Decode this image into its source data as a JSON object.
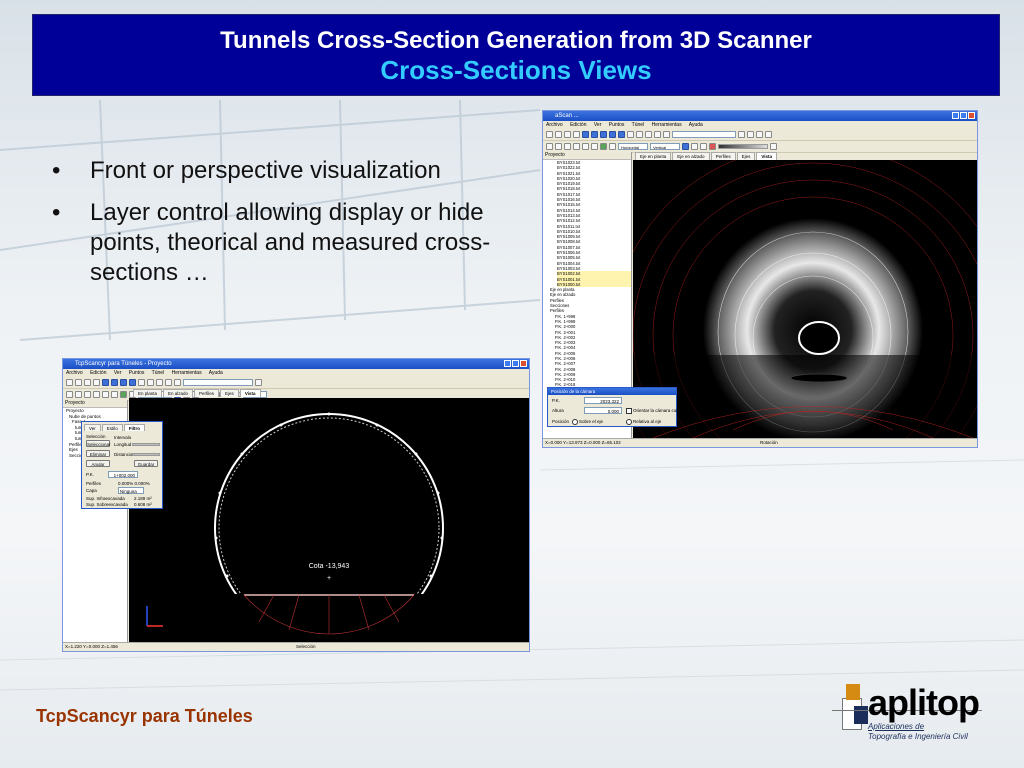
{
  "slide": {
    "title_line1": "Tunnels Cross-Section Generation from 3D Scanner",
    "title_line2": "Cross-Sections Views",
    "bullets": [
      {
        "symbol": "•",
        "text": "Front or perspective visualization"
      },
      {
        "symbol": "•",
        "text": "Layer control allowing display or hide points, theorical and measured cross-sections …"
      }
    ],
    "footer": "TcpScancyr para Túneles",
    "colors": {
      "header_bg": "#000099",
      "title_line1": "#ffffff",
      "title_line2": "#33ccff",
      "footer": "#993300"
    }
  },
  "logo": {
    "name": "aplitop",
    "tagline_line1": "Aplicaciones de",
    "tagline_line2": "Topografía e Ingeniería Civil"
  },
  "window_left": {
    "title": "TcpScancyr para Túneles - Proyecto",
    "menus": [
      "Archivo",
      "Edición",
      "Ver",
      "Puntos",
      "Túnel",
      "Herramientas",
      "Ayuda"
    ],
    "view_combo": "Frontal",
    "pane_title": "Proyecto",
    "tree": [
      "Proyecto",
      "Nube de puntos",
      "Fase 1",
      "tunnel.pts",
      "tunnel.pts",
      "tunnel.pts",
      "Perfiles",
      "Ejes",
      "Secciones"
    ],
    "tabs": [
      "En planta",
      "En alzado",
      "Perfiles",
      "Ejes",
      "Vista"
    ],
    "active_tab": "Vista",
    "canvas_label": "Cota -13,943",
    "status_left": "X=1.220 Y=0.000 Z=1.456",
    "status_mid": "Selección",
    "dialog": {
      "tabs": [
        "Ver",
        "Estilo",
        "Filtro"
      ],
      "group": "Selección",
      "buttons": [
        "Seleccionar",
        "Eliminar",
        "Anular",
        "Guardar"
      ],
      "slider_labels": [
        "Intervalo",
        "Longitud",
        "Distancia"
      ],
      "pk_label": "P.K.",
      "pk_value": "1+002.000",
      "rows": [
        {
          "label": "Perfiles",
          "value": "0.000%  0.000%"
        },
        {
          "label": "Capa",
          "value": "Ninguna"
        },
        {
          "label": "Sup. Infraexcavada",
          "value": "2.189 m²"
        },
        {
          "label": "Sup. Sobreexcavada",
          "value": "0.608 m²"
        }
      ]
    }
  },
  "window_right": {
    "title": "aScan ...",
    "menus": [
      "Archivo",
      "Edición",
      "Ver",
      "Puntos",
      "Túnel",
      "Herramientas",
      "Ayuda"
    ],
    "view_combo": "Horizontal",
    "view_combo2": "Vertical",
    "pane_title": "Proyecto",
    "tree": [
      "BYS1023.txt",
      "BYS1022.txt",
      "BYS1021.txt",
      "BYS1020.txt",
      "BYS1019.txt",
      "BYS1018.txt",
      "BYS1017.txt",
      "BYS1016.txt",
      "BYS1015.txt",
      "BYS1014.txt",
      "BYS1013.txt",
      "BYS1012.txt",
      "BYS1011.txt",
      "BYS1010.txt",
      "BYS1009.txt",
      "BYS1008.txt",
      "BYS1007.txt",
      "BYS1006.txt",
      "BYS1005.txt",
      "BYS1004.txt",
      "BYS1003.txt",
      "BYS1002.txt",
      "BYS1001.txt",
      "BYS1000.txt",
      "Eje en planta",
      "Eje en alzado",
      "Perfiles",
      "Secciones",
      "Perfiles",
      "P.K. 1+998",
      "P.K. 1+999",
      "P.K. 2+000",
      "P.K. 2+001",
      "P.K. 2+002",
      "P.K. 2+003",
      "P.K. 2+004",
      "P.K. 2+005",
      "P.K. 2+006",
      "P.K. 2+007",
      "P.K. 2+008",
      "P.K. 2+009",
      "P.K. 2+010",
      "P.K. 2+018",
      "P.K. 2+019",
      "P.K. 2+020"
    ],
    "tabs": [
      "Eje en planta",
      "Eje en alzado",
      "Perfiles",
      "Ejes",
      "Vista"
    ],
    "active_tab": "Vista",
    "status_left": "X=0.000 Y=13.973 Z=0.000 Z=65.102",
    "status_mid": "Rotación",
    "dialog": {
      "title": "Posición de la cámara",
      "pk_label": "P.K.",
      "pk_value": "2023.322",
      "height_label": "Altura",
      "height_value": "0.000",
      "orient_label": "Orientar la cámara con el eje",
      "position_label": "Posición",
      "on_axis_label": "Sobre el eje",
      "relative_label": "Relativa al eje"
    }
  }
}
